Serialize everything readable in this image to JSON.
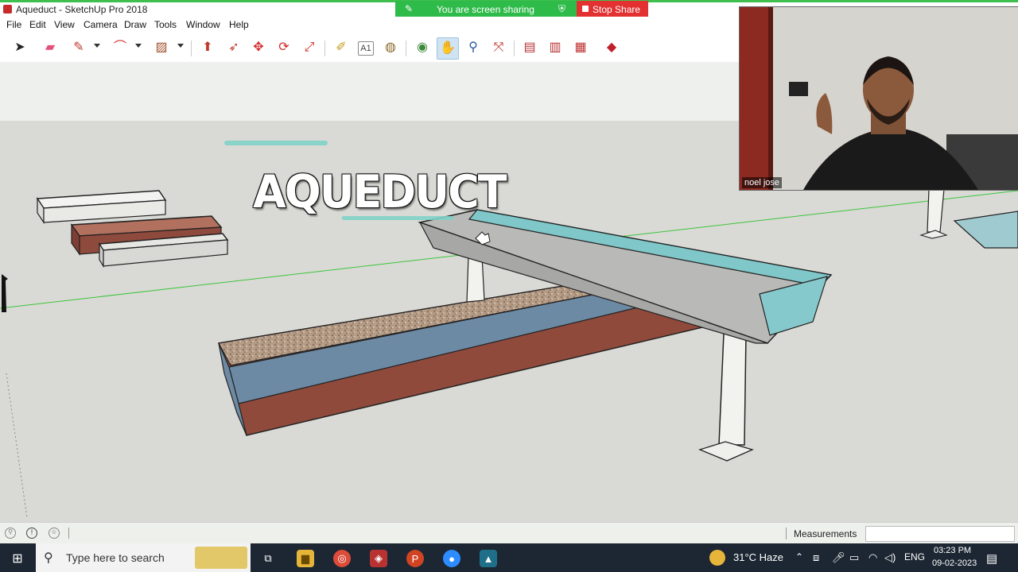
{
  "window": {
    "title": "Aqueduct - SketchUp Pro 2018"
  },
  "share": {
    "status": "You are screen sharing",
    "stop_label": "Stop Share"
  },
  "menu": [
    "File",
    "Edit",
    "View",
    "Camera",
    "Draw",
    "Tools",
    "Window",
    "Help"
  ],
  "toolbar": {
    "tools": [
      "select",
      "eraser",
      "pencil-line",
      "arc",
      "rectangle",
      "push-pull",
      "follow-me",
      "move",
      "rotate",
      "scale",
      "tape-measure",
      "text",
      "paint-bucket",
      "orbit",
      "pan",
      "zoom",
      "zoom-extents",
      "warehouse",
      "extension-warehouse",
      "layout",
      "ruby"
    ],
    "active_tool": "pan"
  },
  "scene": {
    "overlay_title": "AQUEDUCT"
  },
  "webcam": {
    "participant_name": "noel jose"
  },
  "statusbar": {
    "measurements_label": "Measurements",
    "measurements_value": ""
  },
  "taskbar": {
    "search_placeholder": "Type here to search",
    "weather": "31°C  Haze",
    "language": "ENG",
    "time": "03:23 PM",
    "date": "09-02-2023"
  },
  "colors": {
    "share_green": "#2fbb4a",
    "stop_red": "#e33131",
    "axis_green": "#3cc43c",
    "water": "#7fc7c9",
    "brick": "#9a4a3c"
  }
}
